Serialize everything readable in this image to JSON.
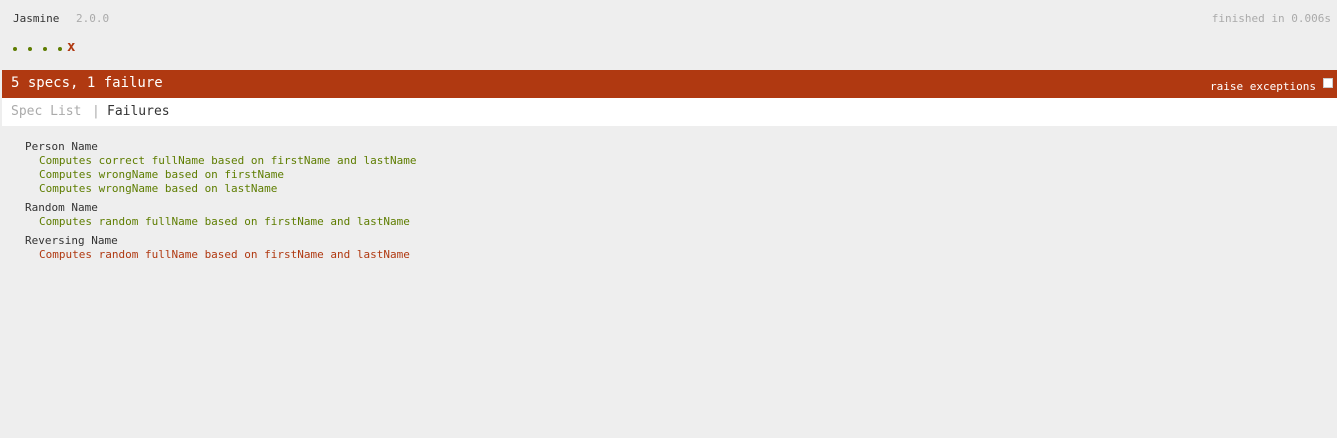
{
  "banner": {
    "title": "Jasmine",
    "version": "2.0.0",
    "duration": "finished in 0.006s"
  },
  "symbols": [
    "passed",
    "passed",
    "passed",
    "passed",
    "failed"
  ],
  "failed_symbol": "x",
  "alert": {
    "summary": "5 specs, 1 failure",
    "raise_exceptions_label": "raise exceptions",
    "raise_exceptions_checked": false
  },
  "menu": {
    "spec_list_label": "Spec List",
    "separator": "|",
    "failures_label": "Failures"
  },
  "suites": [
    {
      "name": "Person Name",
      "specs": [
        {
          "label": "Computes correct fullName based on firstName and lastName",
          "status": "passed"
        },
        {
          "label": "Computes wrongName based on firstName",
          "status": "passed"
        },
        {
          "label": "Computes wrongName based on lastName",
          "status": "passed"
        }
      ]
    },
    {
      "name": "Random Name",
      "specs": [
        {
          "label": "Computes random fullName based on firstName and lastName",
          "status": "passed"
        }
      ]
    },
    {
      "name": "Reversing Name",
      "specs": [
        {
          "label": "Computes random fullName based on firstName and lastName",
          "status": "failed"
        }
      ]
    }
  ],
  "colors": {
    "passed": "#5e7d00",
    "failed": "#b03911",
    "background": "#eeeeee"
  }
}
